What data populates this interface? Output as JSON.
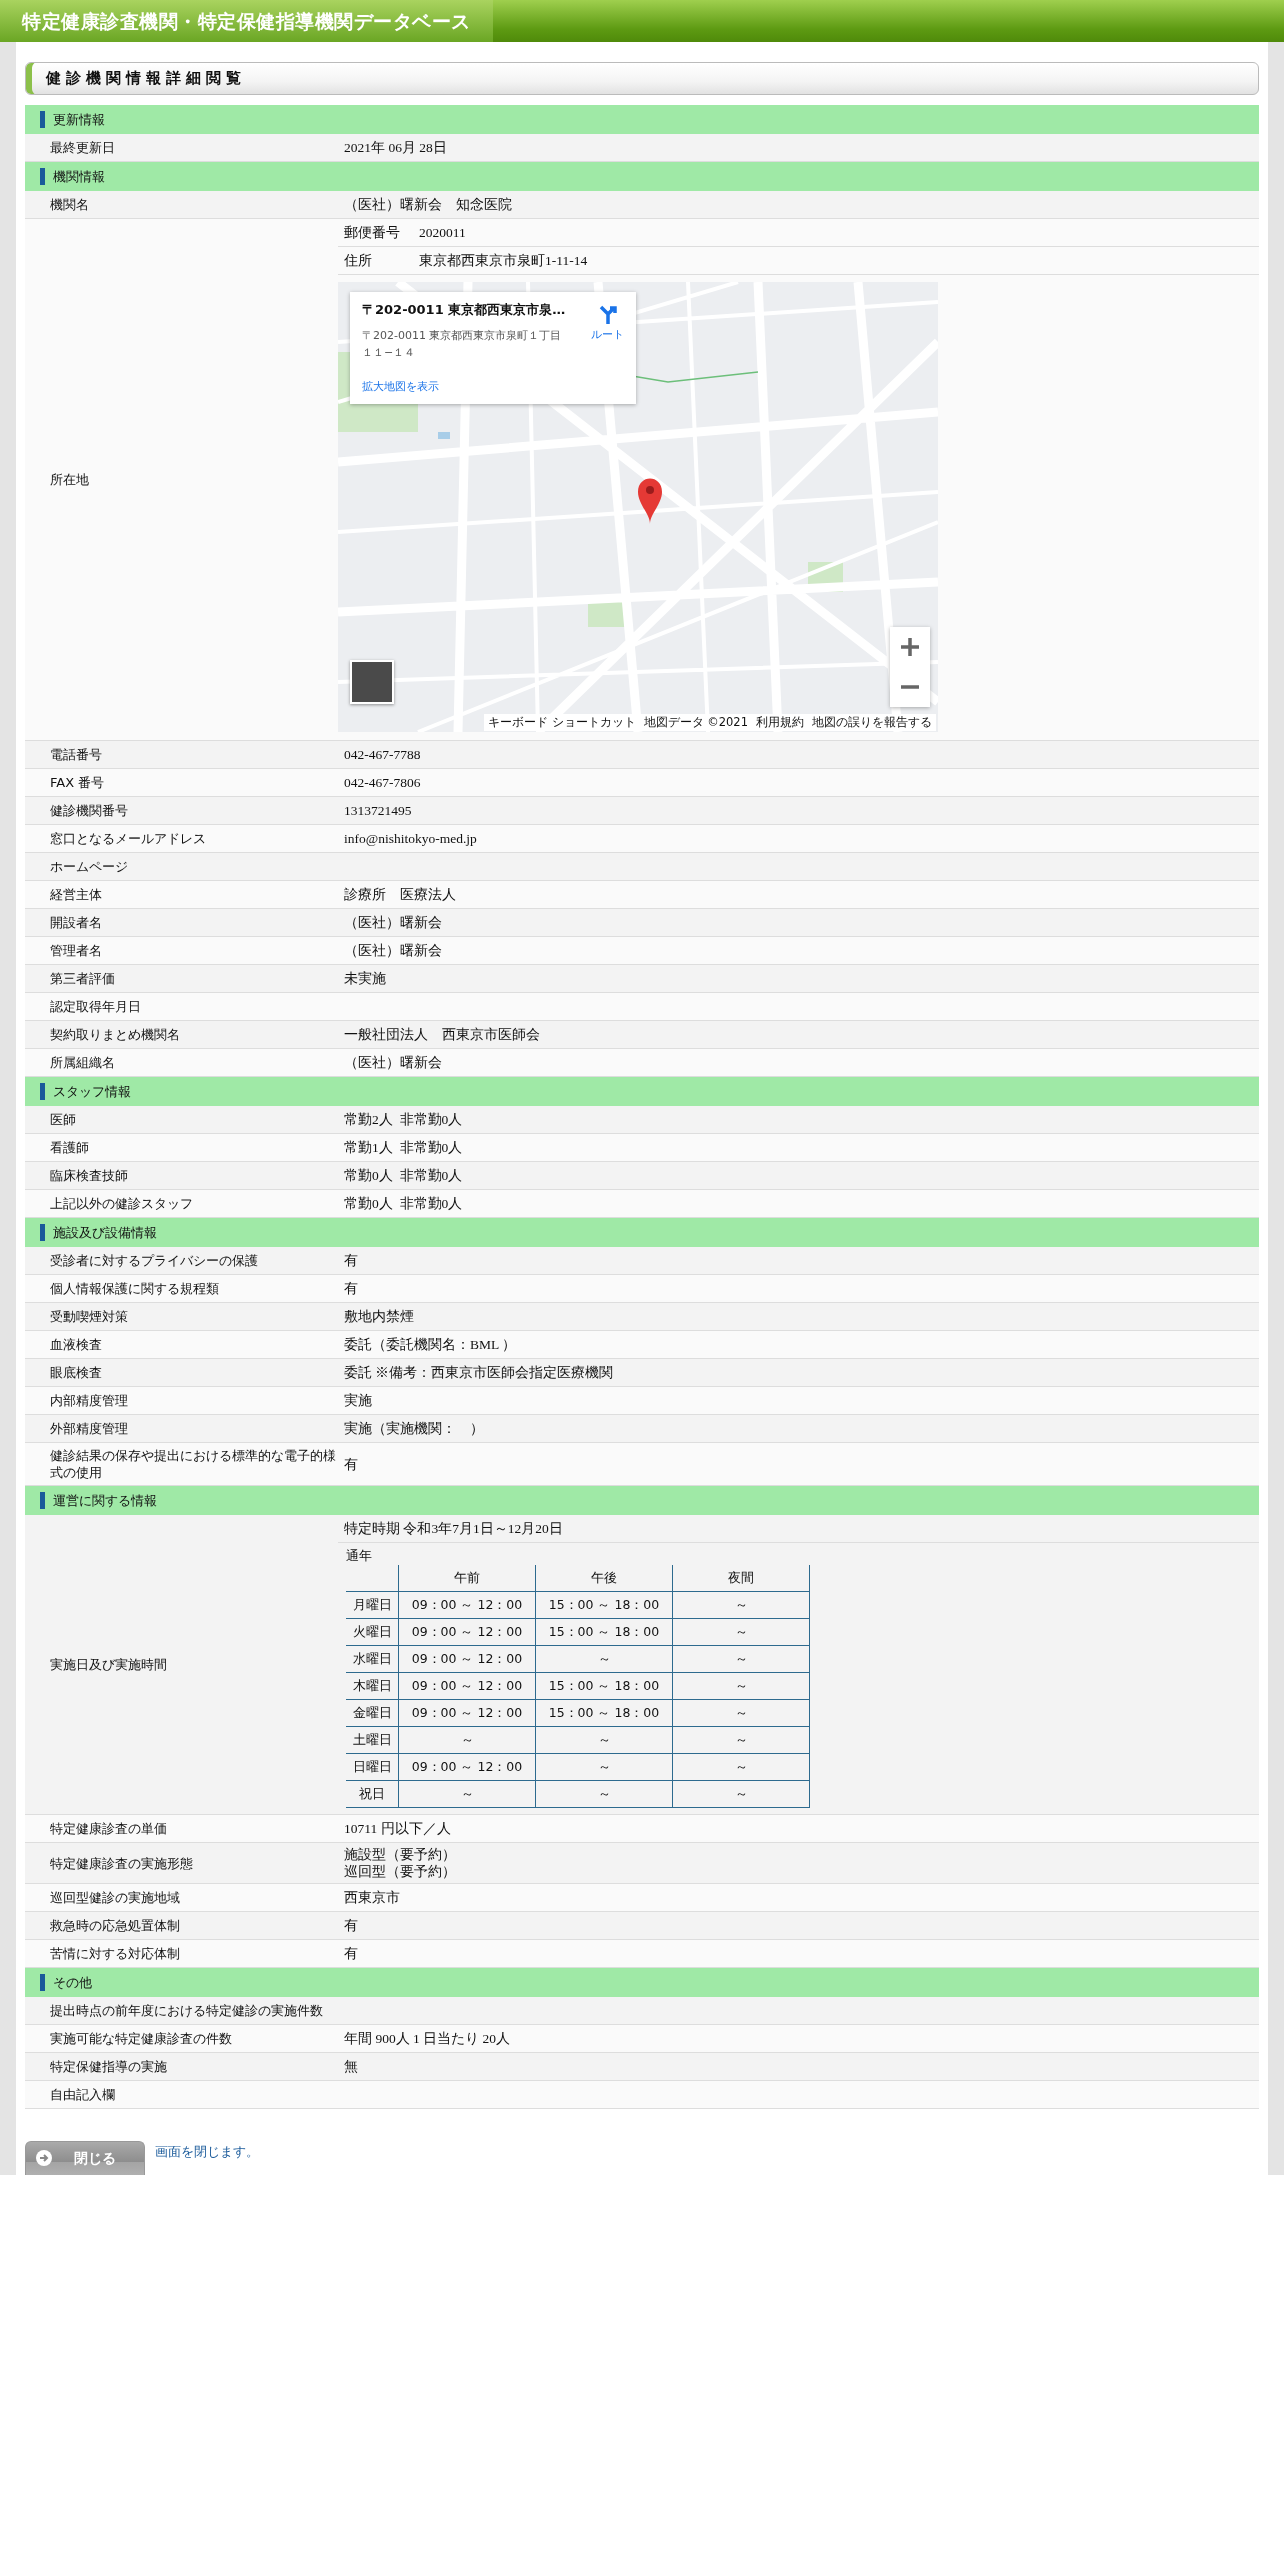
{
  "header": {
    "title": "特定健康診査機関・特定保健指導機関データベース"
  },
  "page_title": "健診機関情報詳細閲覧",
  "sections": [
    {
      "title": "更新情報",
      "rows": [
        {
          "kind": "text",
          "label": "最終更新日",
          "value": "2021年 06月 28日"
        }
      ]
    },
    {
      "title": "機関情報",
      "rows": [
        {
          "kind": "text",
          "label": "機関名",
          "value": "（医社）曙新会　知念医院"
        },
        {
          "kind": "location",
          "label": "所在地",
          "fields": [
            {
              "label": "郵便番号",
              "value": "2020011"
            },
            {
              "label": "住所",
              "value": "東京都西東京市泉町1-11-14"
            }
          ],
          "map": {
            "kind": "picture",
            "popup": {
              "title": "〒202-0011 東京都西東京市泉…",
              "address": "〒202-0011 東京都西東京市泉町１丁目１１−１４",
              "route": "ルート",
              "larger_map": "拡大地図を表示"
            },
            "attribution": [
              "キーボード ショートカット",
              "地図データ ©2021",
              "利用規約",
              "地図の誤りを報告する"
            ]
          }
        },
        {
          "kind": "text",
          "label": "電話番号",
          "value": "042-467-7788"
        },
        {
          "kind": "text",
          "label": "FAX 番号",
          "value": "042-467-7806"
        },
        {
          "kind": "text",
          "label": "健診機関番号",
          "value": "1313721495"
        },
        {
          "kind": "text",
          "label": "窓口となるメールアドレス",
          "value": "info@nishitokyo-med.jp"
        },
        {
          "kind": "text",
          "label": "ホームページ"
        },
        {
          "kind": "text",
          "label": "経営主体",
          "value": "診療所　医療法人"
        },
        {
          "kind": "text",
          "label": "開設者名",
          "value": "（医社）曙新会"
        },
        {
          "kind": "text",
          "label": "管理者名",
          "value": "（医社）曙新会"
        },
        {
          "kind": "text",
          "label": "第三者評価",
          "value": "未実施"
        },
        {
          "kind": "text",
          "label": "認定取得年月日"
        },
        {
          "kind": "text",
          "label": "契約取りまとめ機関名",
          "value": "一般社団法人　西東京市医師会"
        },
        {
          "kind": "text",
          "label": "所属組織名",
          "value": "（医社）曙新会"
        }
      ]
    },
    {
      "title": "スタッフ情報",
      "rows": [
        {
          "kind": "text",
          "label": "医師",
          "value": "常勤2人  非常勤0人"
        },
        {
          "kind": "text",
          "label": "看護師",
          "value": "常勤1人  非常勤0人"
        },
        {
          "kind": "text",
          "label": "臨床検査技師",
          "value": "常勤0人  非常勤0人"
        },
        {
          "kind": "text",
          "label": "上記以外の健診スタッフ",
          "value": "常勤0人  非常勤0人"
        }
      ]
    },
    {
      "title": "施設及び設備情報",
      "rows": [
        {
          "kind": "text",
          "label": "受診者に対するプライバシーの保護",
          "value": "有"
        },
        {
          "kind": "text",
          "label": "個人情報保護に関する規程類",
          "value": "有"
        },
        {
          "kind": "text",
          "label": "受動喫煙対策",
          "value": "敷地内禁煙"
        },
        {
          "kind": "text",
          "label": "血液検査",
          "value": "委託（委託機関名：BML ）"
        },
        {
          "kind": "text",
          "label": "眼底検査",
          "value": "委託 ※備考：西東京市医師会指定医療機関"
        },
        {
          "kind": "text",
          "label": "内部精度管理",
          "value": "実施"
        },
        {
          "kind": "text",
          "label": "外部精度管理",
          "value": "実施（実施機関：　）"
        },
        {
          "kind": "text",
          "label": "健診結果の保存や提出における標準的な電子的様式の使用",
          "value": "有"
        }
      ]
    },
    {
      "title": "運営に関する情報",
      "rows": [
        {
          "kind": "schedule",
          "label": "実施日及び実施時間",
          "period": "特定時期 令和3年7月1日～12月20日",
          "caption": "通年",
          "columns": [
            "午前",
            "午後",
            "夜間"
          ],
          "days": [
            {
              "day": "月曜日",
              "slots": [
                "09：00 ～ 12：00",
                "15：00 ～ 18：00",
                "～"
              ]
            },
            {
              "day": "火曜日",
              "slots": [
                "09：00 ～ 12：00",
                "15：00 ～ 18：00",
                "～"
              ]
            },
            {
              "day": "水曜日",
              "slots": [
                "09：00 ～ 12：00",
                "～",
                "～"
              ]
            },
            {
              "day": "木曜日",
              "slots": [
                "09：00 ～ 12：00",
                "15：00 ～ 18：00",
                "～"
              ]
            },
            {
              "day": "金曜日",
              "slots": [
                "09：00 ～ 12：00",
                "15：00 ～ 18：00",
                "～"
              ]
            },
            {
              "day": "土曜日",
              "slots": [
                "～",
                "～",
                "～"
              ]
            },
            {
              "day": "日曜日",
              "slots": [
                "09：00 ～ 12：00",
                "～",
                "～"
              ]
            },
            {
              "day": "祝日",
              "slots": [
                "～",
                "～",
                "～"
              ]
            }
          ]
        },
        {
          "kind": "text",
          "label": "特定健康診査の単価",
          "value": "10711 円以下／人"
        },
        {
          "kind": "lines",
          "label": "特定健康診査の実施形態",
          "values": [
            "施設型（要予約）",
            "巡回型（要予約）"
          ]
        },
        {
          "kind": "text",
          "label": "巡回型健診の実施地域",
          "value": "西東京市"
        },
        {
          "kind": "text",
          "label": "救急時の応急処置体制",
          "value": "有"
        },
        {
          "kind": "text",
          "label": "苦情に対する対応体制",
          "value": "有"
        }
      ]
    },
    {
      "title": "その他",
      "rows": [
        {
          "kind": "text",
          "label": "提出時点の前年度における特定健診の実施件数"
        },
        {
          "kind": "text",
          "label": "実施可能な特定健康診査の件数",
          "value": "年間 900人 1 日当たり 20人"
        },
        {
          "kind": "text",
          "label": "特定保健指導の実施",
          "value": "無"
        },
        {
          "kind": "text",
          "label": "自由記入欄"
        }
      ]
    }
  ],
  "close": {
    "button": "閉じる",
    "note": "画面を閉じます。"
  }
}
